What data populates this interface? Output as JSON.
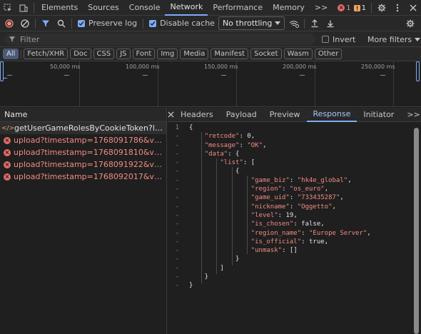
{
  "tabs": [
    "Elements",
    "Sources",
    "Console",
    "Network",
    "Performance",
    "Memory"
  ],
  "more_tabs": ">>",
  "status": {
    "errors": "1",
    "warnings": "1"
  },
  "toolbar": {
    "preserve_log": "Preserve log",
    "disable_cache": "Disable cache",
    "throttling": "No throttling"
  },
  "filter": {
    "placeholder": "Filter",
    "invert": "Invert",
    "more_filters": "More filters"
  },
  "chips": [
    "All",
    "Fetch/XHR",
    "Doc",
    "CSS",
    "JS",
    "Font",
    "Img",
    "Media",
    "Manifest",
    "Socket",
    "Wasm",
    "Other"
  ],
  "overview_ticks": [
    "50,000 ms",
    "100,000 ms",
    "150,000 ms",
    "200,000 ms",
    "250,000 ms"
  ],
  "list_header": "Name",
  "requests": [
    {
      "name": "getUserGameRolesByCookieToken?lang=en...",
      "status": "ok"
    },
    {
      "name": "upload?timestamp=1768091786&verification...",
      "status": "error"
    },
    {
      "name": "upload?timestamp=1768091810&verification...",
      "status": "error"
    },
    {
      "name": "upload?timestamp=1768091922&verification...",
      "status": "error"
    },
    {
      "name": "upload?timestamp=1768092017&verification...",
      "status": "error"
    }
  ],
  "detail_tabs": [
    "Headers",
    "Payload",
    "Preview",
    "Response",
    "Initiator"
  ],
  "detail_more": ">>",
  "response_lines": [
    {
      "num": "1",
      "text": "{"
    },
    {
      "num": "-",
      "text": "    \"retcode\": 0,"
    },
    {
      "num": "-",
      "text": "    \"message\": \"OK\","
    },
    {
      "num": "-",
      "text": "    \"data\": {"
    },
    {
      "num": "-",
      "text": "        \"list\": ["
    },
    {
      "num": "-",
      "text": "            {"
    },
    {
      "num": "-",
      "text": "                \"game_biz\": \"hk4e_global\","
    },
    {
      "num": "-",
      "text": "                \"region\": \"os_euro\","
    },
    {
      "num": "-",
      "text": "                \"game_uid\": \"733435287\","
    },
    {
      "num": "-",
      "text": "                \"nickname\": \"Oggetto\","
    },
    {
      "num": "-",
      "text": "                \"level\": 19,"
    },
    {
      "num": "-",
      "text": "                \"is_chosen\": false,"
    },
    {
      "num": "-",
      "text": "                \"region_name\": \"Europe Server\","
    },
    {
      "num": "-",
      "text": "                \"is_official\": true,"
    },
    {
      "num": "-",
      "text": "                \"unmask\": []"
    },
    {
      "num": "-",
      "text": "            }"
    },
    {
      "num": "-",
      "text": "        ]"
    },
    {
      "num": "-",
      "text": "    }"
    },
    {
      "num": "-",
      "text": "}"
    }
  ],
  "colors": {
    "accent": "#7cacf8",
    "error": "#f28b82",
    "active_tab_text": "#a8c7fa"
  }
}
